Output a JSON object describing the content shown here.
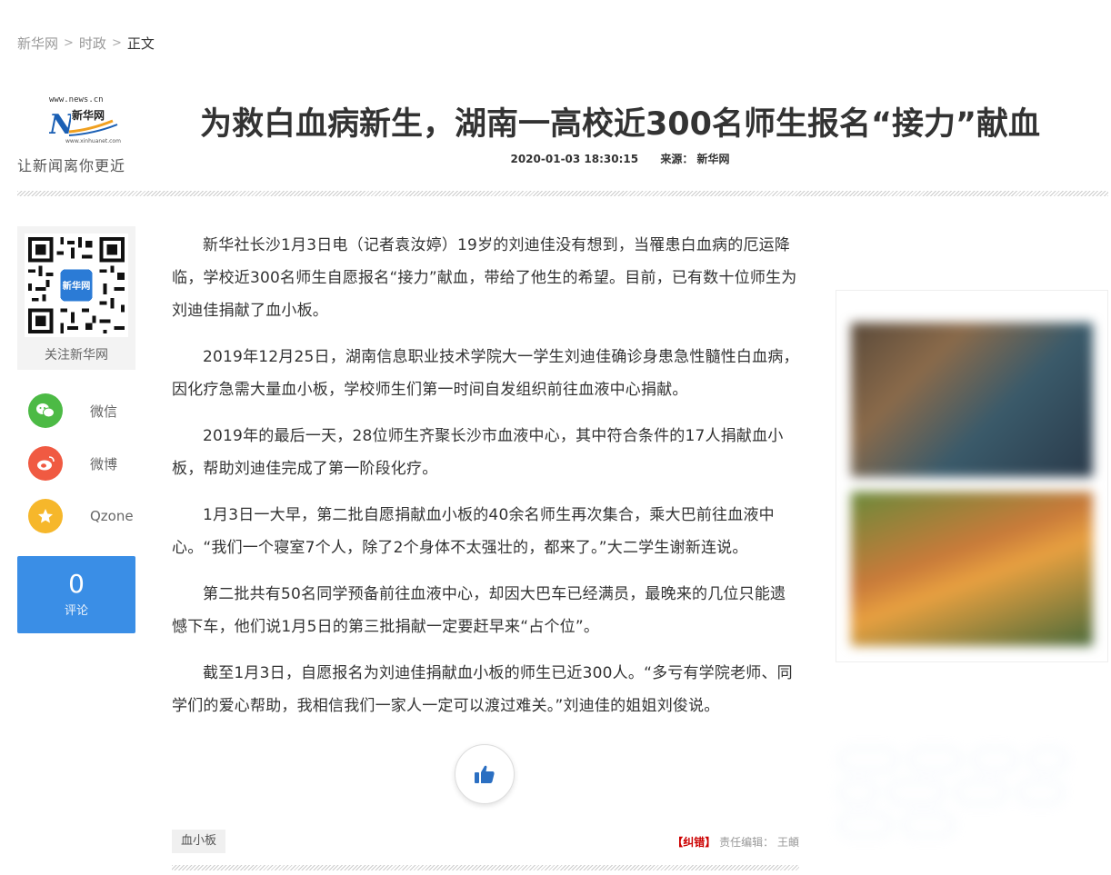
{
  "breadcrumb": {
    "items": [
      "新华网",
      "时政"
    ],
    "separator": ">",
    "current": "正文"
  },
  "header": {
    "logo_url": "www.news.cn",
    "logo_slogan": "让新闻离你更近",
    "title": "为救白血病新生，湖南一高校近300名师生报名“接力”献血",
    "datetime": "2020-01-03 18:30:15",
    "source": "来源：  新华网"
  },
  "sidebar": {
    "qr_caption": "关注新华网",
    "share": [
      {
        "label": "微信",
        "icon": "wechat-icon",
        "color": "#4cba45"
      },
      {
        "label": "微博",
        "icon": "weibo-icon",
        "color": "#f05a42"
      },
      {
        "label": "Qzone",
        "icon": "qzone-icon",
        "color": "#f6b72b"
      }
    ],
    "comment_count": "0",
    "comment_label": "评论"
  },
  "article": {
    "paragraphs": [
      "新华社长沙1月3日电（记者袁汝婷）19岁的刘迪佳没有想到，当罹患白血病的厄运降临，学校近300名师生自愿报名“接力”献血，带给了他生的希望。目前，已有数十位师生为刘迪佳捐献了血小板。",
      "2019年12月25日，湖南信息职业技术学院大一学生刘迪佳确诊身患急性髓性白血病，因化疗急需大量血小板，学校师生们第一时间自发组织前往血液中心捐献。",
      "2019年的最后一天，28位师生齐聚长沙市血液中心，其中符合条件的17人捐献血小板，帮助刘迪佳完成了第一阶段化疗。",
      "1月3日一大早，第二批自愿捐献血小板的40余名师生再次集合，乘大巴前往血液中心。“我们一个寝室7个人，除了2个身体不太强壮的，都来了。”大二学生谢新连说。",
      "第二批共有50名同学预备前往血液中心，却因大巴车已经满员，最晚来的几位只能遗憾下车，他们说1月5日的第三批捐献一定要赶早来“占个位”。",
      "截至1月3日，自愿报名为刘迪佳捐献血小板的师生已近300人。“多亏有学院老师、同学们的爱心帮助，我相信我们一家人一定可以渡过难关。”刘迪佳的姐姐刘俊说。"
    ],
    "tag": "血小板",
    "correction": "【纠错】",
    "editor_label": "责任编辑：",
    "editor_name": "王頔"
  },
  "colors": {
    "accent": "#3a8ee6",
    "correction": "#cc0000"
  }
}
